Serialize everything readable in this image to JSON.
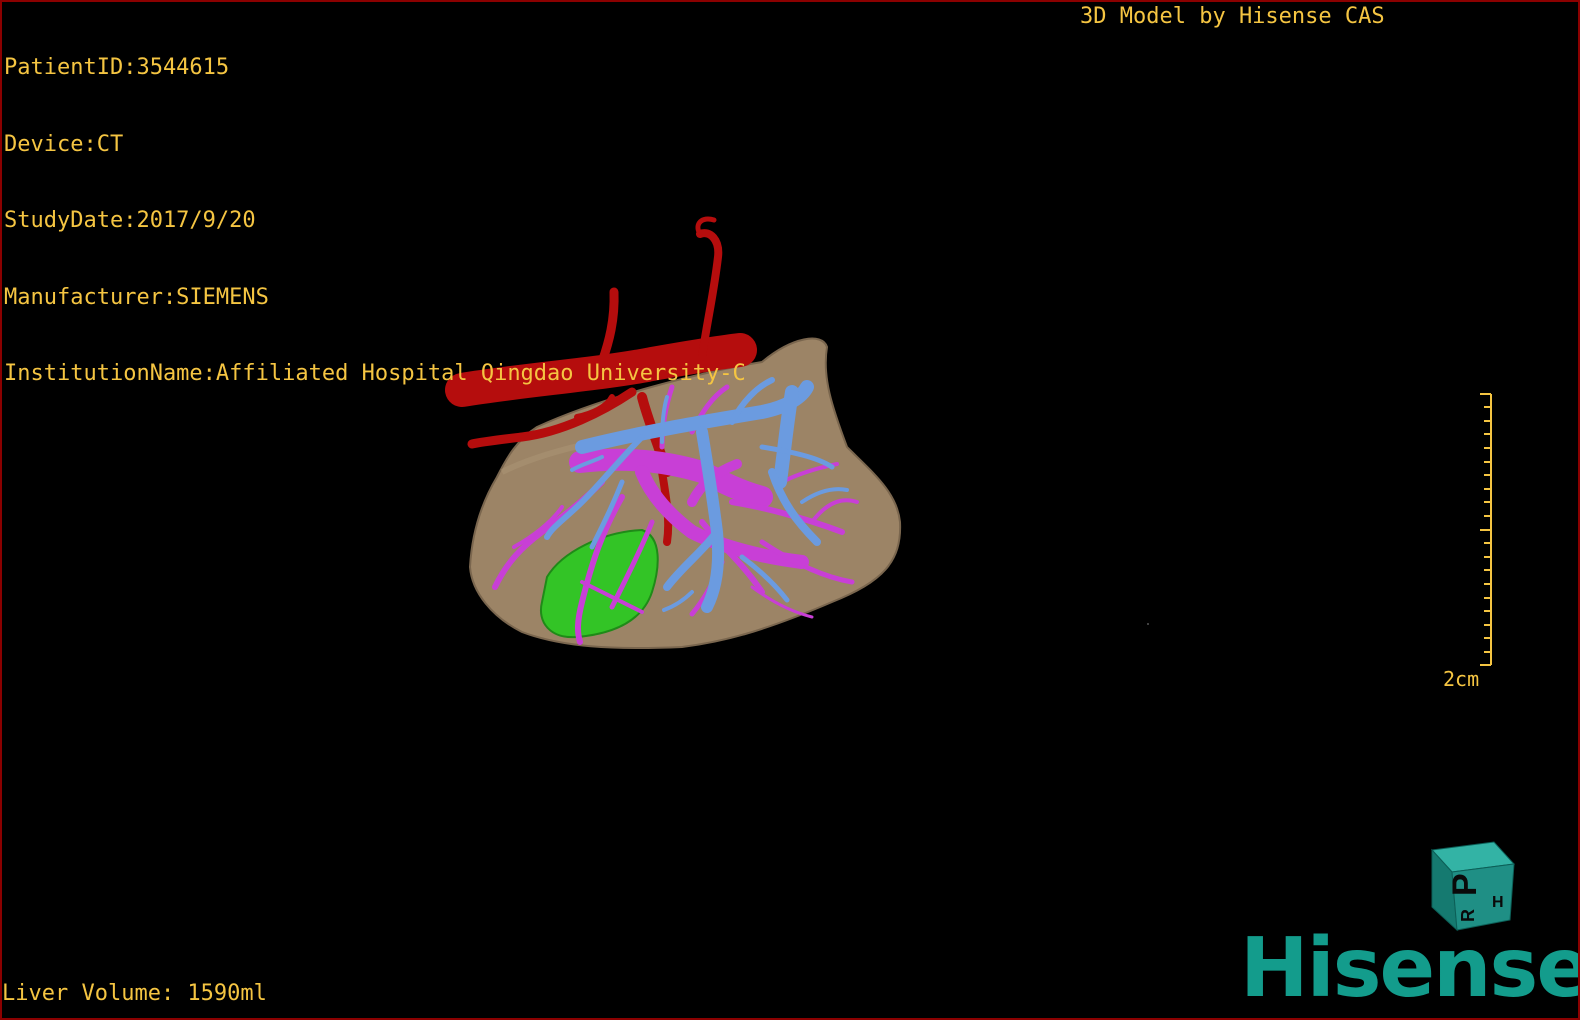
{
  "overlay": {
    "patient_id": "PatientID:3544615",
    "device": "Device:CT",
    "study_date": "StudyDate:2017/9/20",
    "manufacturer": "Manufacturer:SIEMENS",
    "institution": "InstitutionName:Affiliated Hospital Qingdao University-C",
    "model_credit": "3D Model by Hisense CAS",
    "liver_volume": "Liver Volume: 1590ml"
  },
  "scale_bar": {
    "label": "2cm"
  },
  "orientation_cube": {
    "front_letter": "P",
    "side_letter_1": "H",
    "side_letter_2": "R"
  },
  "logo": {
    "text": "Hisense"
  },
  "colors": {
    "overlay_text": "#f5c542",
    "liver": "#9c8466",
    "artery": "#b50d0d",
    "portal_vein": "#c83fd6",
    "hepatic_vein": "#6b9be0",
    "gallbladder": "#33c426",
    "logo": "#139c8c",
    "cube": "#1f8f85",
    "frame": "#8b0000"
  }
}
